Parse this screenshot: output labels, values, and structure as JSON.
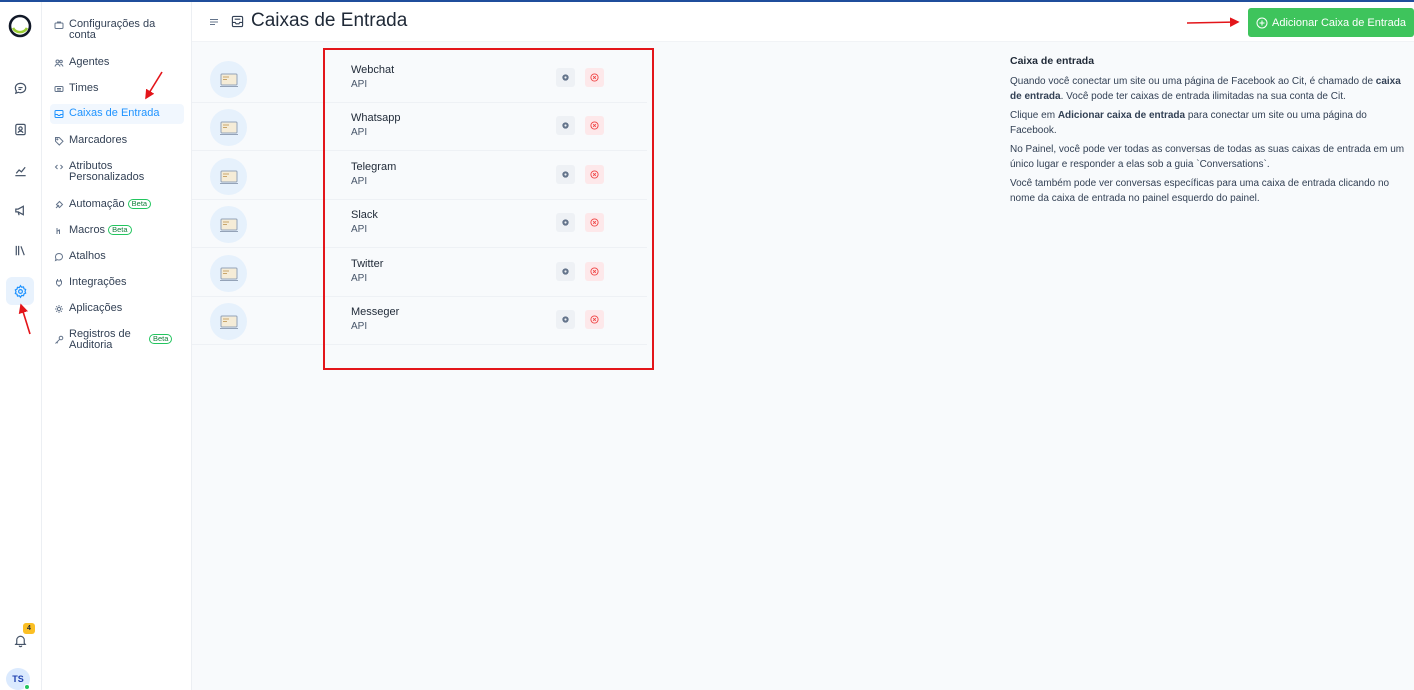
{
  "rail": {
    "icons": [
      "logo-icon",
      "chat-icon",
      "contacts-icon",
      "reports-icon",
      "campaigns-icon",
      "library-icon",
      "settings-icon",
      "bell-icon"
    ],
    "notification_count": "4",
    "avatar_initials": "TS"
  },
  "sidebar": {
    "items": [
      {
        "label": "Configurações da conta",
        "icon": "briefcase-icon"
      },
      {
        "label": "Agentes",
        "icon": "people-icon"
      },
      {
        "label": "Times",
        "icon": "team-icon"
      },
      {
        "label": "Caixas de Entrada",
        "icon": "inbox-icon"
      },
      {
        "label": "Marcadores",
        "icon": "tag-icon"
      },
      {
        "label": "Atributos Personalizados",
        "icon": "code-icon"
      },
      {
        "label": "Automação",
        "icon": "automation-icon",
        "badge": "Beta"
      },
      {
        "label": "Macros",
        "icon": "macro-icon",
        "badge": "Beta"
      },
      {
        "label": "Atalhos",
        "icon": "shortcut-icon"
      },
      {
        "label": "Integrações",
        "icon": "plug-icon"
      },
      {
        "label": "Aplicações",
        "icon": "apps-icon"
      },
      {
        "label": "Registros de Auditoria",
        "icon": "key-icon",
        "badge": "Beta"
      }
    ]
  },
  "header": {
    "title": "Caixas de Entrada",
    "add_button": "Adicionar Caixa de Entrada"
  },
  "inboxes": [
    {
      "name": "Webchat",
      "type": "API"
    },
    {
      "name": "Whatsapp",
      "type": "API"
    },
    {
      "name": "Telegram",
      "type": "API"
    },
    {
      "name": "Slack",
      "type": "API"
    },
    {
      "name": "Twitter",
      "type": "API"
    },
    {
      "name": "Messeger",
      "type": "API"
    }
  ],
  "help": {
    "title": "Caixa de entrada",
    "p1_a": "Quando você conectar um site ou uma página de Facebook ao Cit, é chamado de ",
    "p1_b": "caixa de entrada",
    "p1_c": ". Você pode ter caixas de entrada ilimitadas na sua conta de Cit.",
    "p2_a": "Clique em ",
    "p2_b": "Adicionar caixa de entrada",
    "p2_c": " para conectar um site ou uma página do Facebook.",
    "p3": "No Painel, você pode ver todas as conversas de todas as suas caixas de entrada em um único lugar e responder a elas sob a guia `Conversations`.",
    "p4": "Você também pode ver conversas específicas para uma caixa de entrada clicando no nome da caixa de entrada no painel esquerdo do painel."
  },
  "colors": {
    "accent": "#1f93ff",
    "add_button": "#3ec45c",
    "annotation": "#e3151a",
    "beta_badge": "#22c55e"
  }
}
